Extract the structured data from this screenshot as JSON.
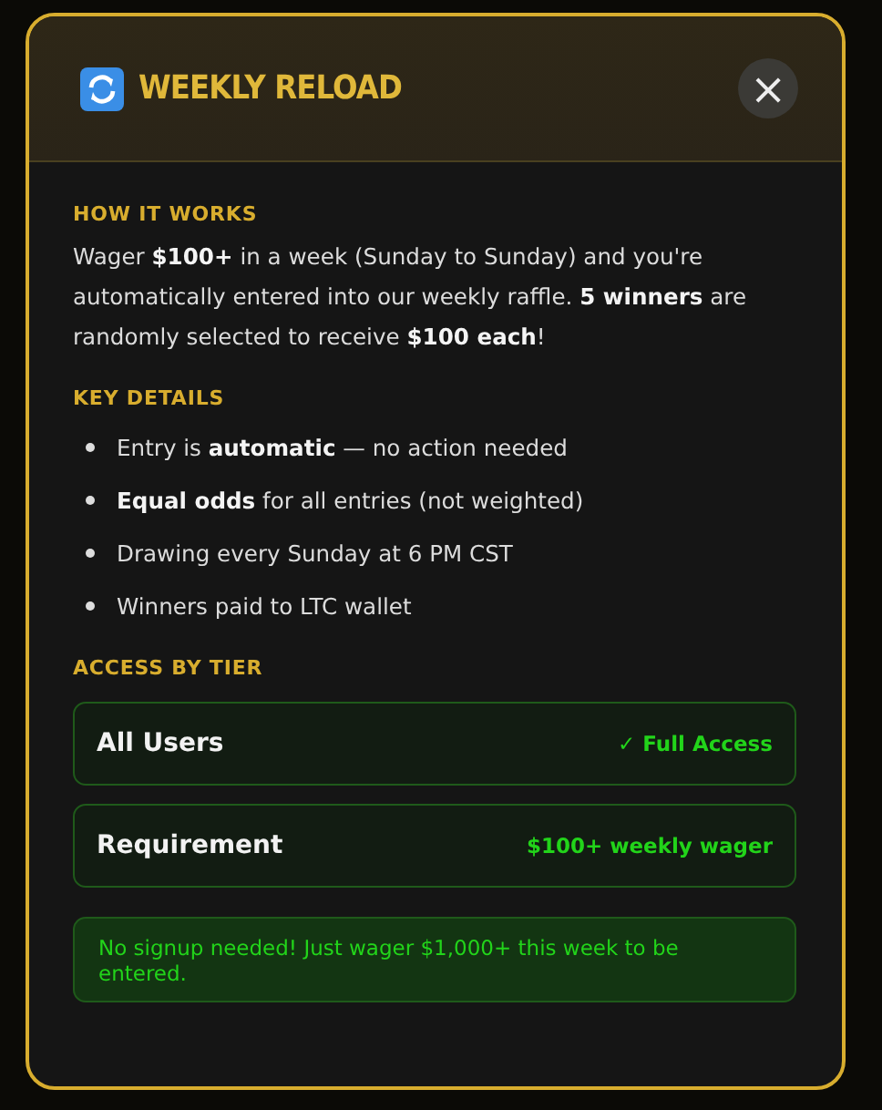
{
  "modal": {
    "title": "WEEKLY RELOAD",
    "close": "×"
  },
  "how_it_works": {
    "heading": "HOW IT WORKS",
    "text": "Wager **$100+** in a week (Sunday to Sunday) and you're automatically entered into our weekly raffle. **5 winners** are randomly selected to receive **$100 each**!"
  },
  "key_details": {
    "heading": "KEY DETAILS",
    "items": [
      "Entry is **automatic** — no action needed",
      "**Equal odds** for all entries (not weighted)",
      "Drawing every Sunday at 6 PM CST",
      "Winners paid to LTC wallet"
    ]
  },
  "access_by_tier": {
    "heading": "ACCESS BY TIER",
    "rows": [
      {
        "label": "All Users",
        "value": "✓ Full Access"
      },
      {
        "label": "Requirement",
        "value": "$100+ weekly wager"
      }
    ]
  },
  "notice": "No signup needed! Just wager $1,000+ this week to be entered."
}
